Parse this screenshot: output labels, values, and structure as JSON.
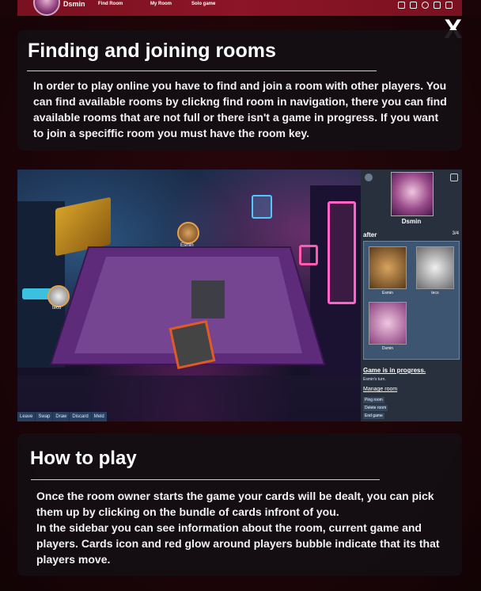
{
  "header": {
    "username": "Dsmin",
    "nav": [
      "Find Room",
      "My Room",
      "Solo game"
    ]
  },
  "modal": {
    "close_label": "X",
    "section1": {
      "title": "Finding and joining rooms",
      "body": "In order to play online you have to find and join a room with other players. You can find available rooms by clickng find room in navigation, there you can find available rooms that are not full or there isn't a game in progress. If you want to join a speciffic room you must have the room key."
    },
    "section2": {
      "title": "How to play",
      "body_line1": "Once the room owner starts the game your cards will be dealt, you can pick them up by clicking on the bundle of cards infront of you.",
      "body_line2": "In the sidebar you can see information about the room, current game and players. Cards icon and red glow around players bubble indicate that its that players move."
    }
  },
  "screenshot": {
    "player_top": "Esmin",
    "player_left": "teco",
    "actions": [
      "Leave",
      "Swap",
      "Draw",
      "Discard",
      "Meld"
    ],
    "sidebar": {
      "profile_name": "Dsmin",
      "room_name": "after",
      "player_count": "3/4",
      "players": [
        "Esmin",
        "teco",
        "Dsmin"
      ],
      "status": "Game is in progress.",
      "turn": "Esmin's turn.",
      "manage": "Manage room",
      "buttons": [
        "Ping room",
        "Delete room",
        "End game"
      ]
    }
  }
}
